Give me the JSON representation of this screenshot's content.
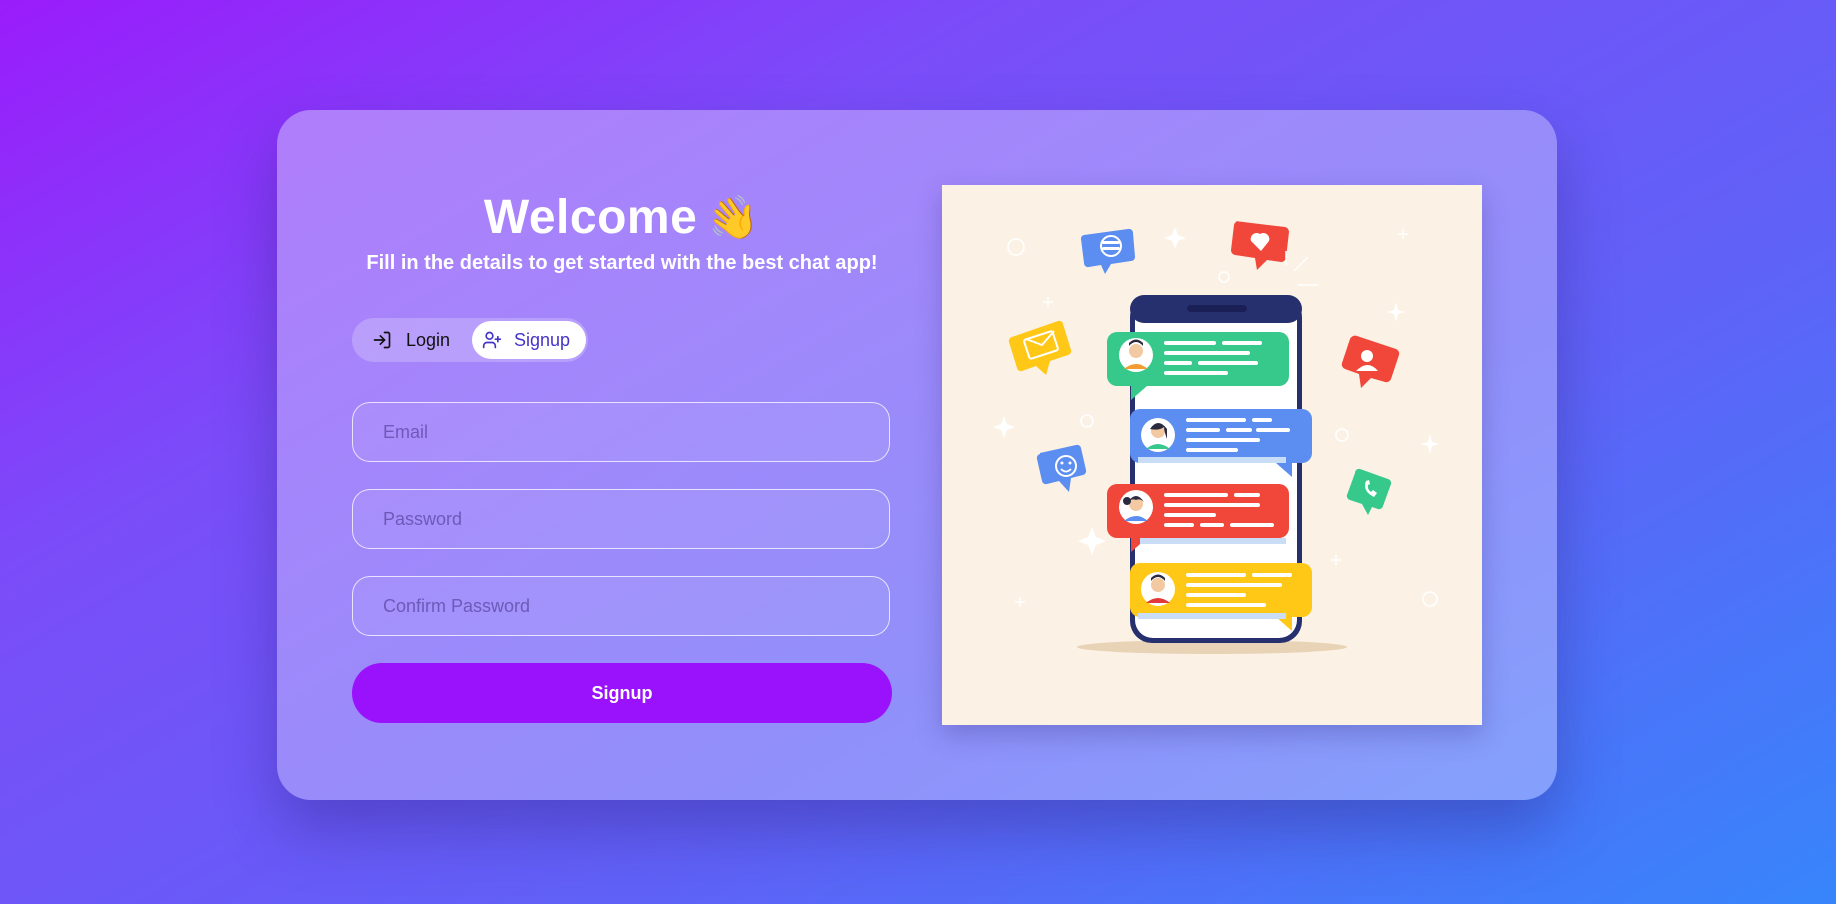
{
  "welcome": {
    "title": "Welcome",
    "wave_emoji": "👋",
    "subtitle": "Fill in the details to get started with the best chat app!"
  },
  "tabs": [
    {
      "label": "Login",
      "icon": "login-icon",
      "active": false
    },
    {
      "label": "Signup",
      "icon": "user-plus-icon",
      "active": true
    }
  ],
  "form": {
    "email_placeholder": "Email",
    "password_placeholder": "Password",
    "confirm_placeholder": "Confirm Password",
    "submit_label": "Signup"
  },
  "colors": {
    "primary": "#9a11fb",
    "active_tab_text": "#4433c8",
    "bubble_green": "#36c98b",
    "bubble_blue": "#5b8ef0",
    "bubble_red": "#f0473a",
    "bubble_yellow": "#ffc716",
    "illustration_bg": "#fbf1e5"
  },
  "illustration": {
    "subject": "phone-with-chat-bubbles",
    "icons": [
      "envelope-icon",
      "heart-icon",
      "message-icon",
      "smiley-icon",
      "user-icon",
      "phone-icon",
      "sparkle-icon"
    ]
  }
}
